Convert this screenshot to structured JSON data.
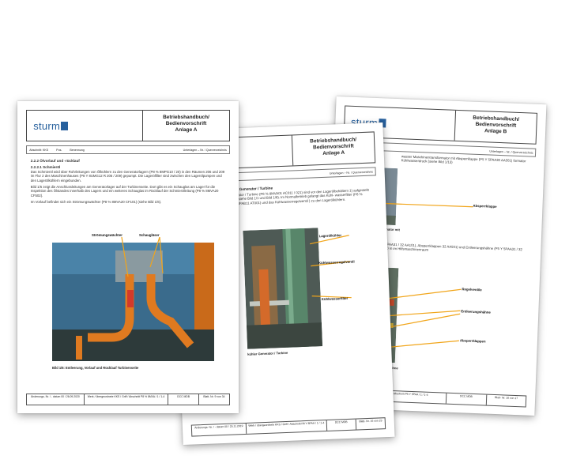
{
  "header": {
    "logo": "sturm",
    "title_line1": "Betriebshandbuch/",
    "title_line2": "Bedienvorschrift",
    "anlage_a": "Anlage A",
    "anlage_b": "Anlage B"
  },
  "meta": {
    "abschnitt": "Abschnitt: KKS",
    "pos": "Pos.",
    "benennung": "Benennung",
    "unterlagen": "Unterlagen – Nr. / Querverzeichnis"
  },
  "page_left": {
    "section": "2.2.2  Ölvorlauf und -rücklauf",
    "subsection": "2.2.2.1  Schmieröl",
    "para1": "Das Schmieröl wird über Rohrleitungen von Ölkühlern zu den Generatorlagern (P8 % 8MPG10 / 20) in den Räumen 206 und 209 im Flur 2 des Maschinenhauses (P8 Y 8UMG12 R 206 / 209) gepumpt. Die Lagerölfilter sind zwischen den Lagerölpumpen und den Lagerölkühlern eingebunden.",
    "para2": "Bild 1/6 zeigt die Anschlussleitungen am Generatorlager auf der Turbinenseite. Dort gibt es ein Schauglas am Lager für die Inspektion des Ölstandes innerhalb des Lagers und ein weiteres Schauglas im Rücklauf der Schmierölleitung (P8 % 8MVA20 CF502).",
    "para3": "Im Vorlauf befindet sich ein Strömungswächter (P8 % 8MVA20 CF101) (siehe Bild 1/6).",
    "label1": "Strömungswächter",
    "label2": "Schaugläser",
    "caption": "Bild 1/6: Entleerung, Vorlauf und Rücklauf Turbinenseite",
    "footer": [
      "Änderungs- Nr. / - datum 00 / 26.09.2020",
      "Werk / übergeordnete KKS / Griff / Abschnitt P8 % 8MVA / 1 / 1-4",
      "DCC MDB",
      "Blatt- Nr. 9 von 34"
    ]
  },
  "page_mid": {
    "heading": "r Generator / Turbine",
    "para": "rator / Turbine (P8 % 8MVA01 AC011 / 021) sind vor den Lagerölbehältern 1) aufgestellt (siehe Bild 1/1 und Bild 1/8). Im Normalbetrieb gelangt das Kühl- wasserfilter (P8 % 8PAB11 AT001) und das Kühlwasserregelventil ) zu den Lagerölkühlern.",
    "label1": "Lagerölkühler",
    "label2": "Kühlwasserregelventil",
    "label3": "Kühlwasserfilter",
    "caption": "kühler Generator / Turbine",
    "footer": [
      "Änderungs- Nr. / - datum 00 / 25.11.2019",
      "Werk / übergeordnete KKS / Griff / Abschnitt P8 Y 8PAA / 1 / 1-4",
      "DCC MDB",
      "Blatt- Nr. 16 von 23"
    ]
  },
  "page_right": {
    "para1": "wasser Maschinentransformator mit Absperrklappe (P5 Y 5PAA30 AA501) formator Kühlwasserdruck (siehe Bild 1/13)",
    "label1": "Absperrklappe",
    "caption1": "Kühlwasser Maschinen- rmator mit Absperrklappe",
    "para2": "enen Regelventile (P5 Y 5PAA31 / 32 AA101), Absperrklappen 32 AA501) und Entleerungshähne (P5 Y 5PAA31 / 32 AA401) auf Ebene +352,10 m im Hilfsmaschinenraum",
    "label2": "Regelventile",
    "label3": "Entleerungshähne",
    "label4": "Absperrklappen",
    "caption2": "ntile, Absperrklappen und Ent- hähne Maschinentransformator",
    "footer": [
      "Werk / übergeordnete KKS / Griff / Abschnitt P5 Y 5PAA / 1 / 1-4",
      "DCC MDB",
      "Blatt- Nr. 10 von 17"
    ]
  }
}
